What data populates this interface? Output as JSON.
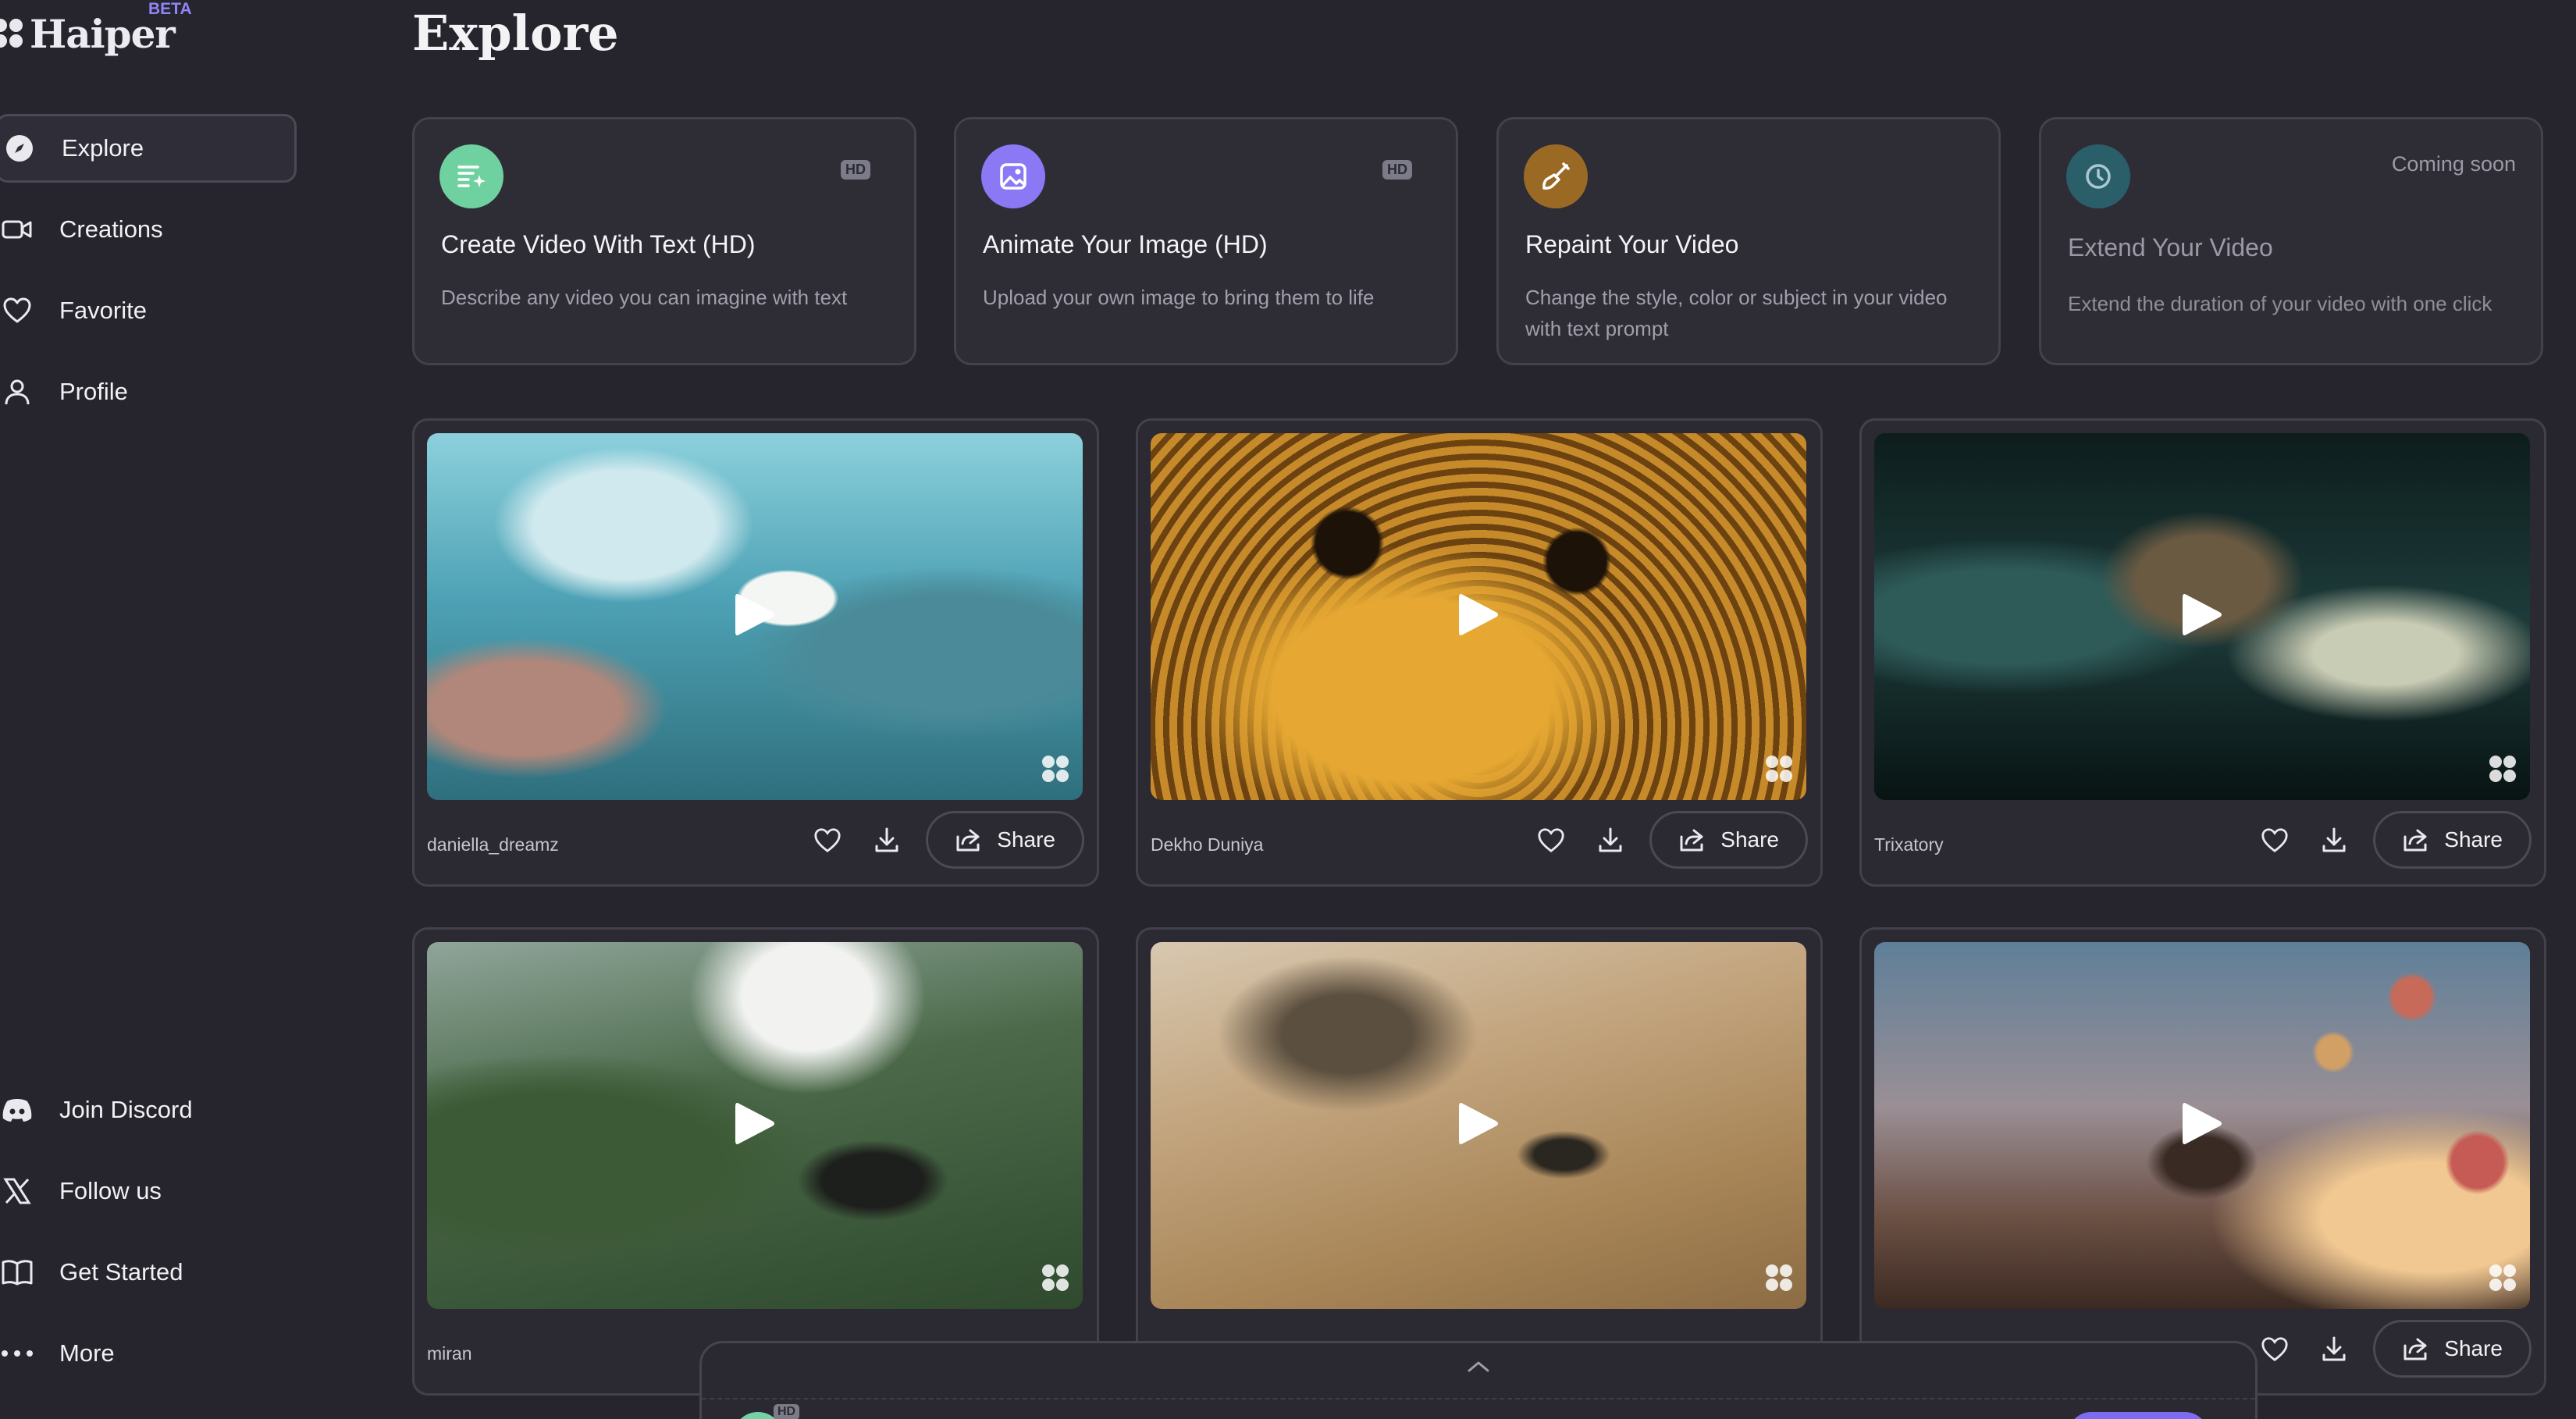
{
  "app": {
    "name": "Haiper",
    "badge": "BETA"
  },
  "sidebar": {
    "items": [
      {
        "label": "Explore",
        "icon": "compass-icon",
        "active": true
      },
      {
        "label": "Creations",
        "icon": "video-camera-icon",
        "active": false
      },
      {
        "label": "Favorite",
        "icon": "heart-icon",
        "active": false
      },
      {
        "label": "Profile",
        "icon": "user-icon",
        "active": false
      }
    ],
    "bottom_items": [
      {
        "label": "Join Discord",
        "icon": "discord-icon"
      },
      {
        "label": "Follow us",
        "icon": "x-logo-icon"
      },
      {
        "label": "Get Started",
        "icon": "book-icon"
      },
      {
        "label": "More",
        "icon": "more-dots-icon"
      }
    ]
  },
  "main": {
    "title": "Explore",
    "tools": [
      {
        "title": "Create Video With Text (HD)",
        "description": "Describe any video you can imagine with text",
        "badge": "HD",
        "icon": "text-to-video-icon",
        "color": "#6fd1a0"
      },
      {
        "title": "Animate Your Image (HD)",
        "description": "Upload your own image to bring them to life",
        "badge": "HD",
        "icon": "image-icon",
        "color": "#8a78f5"
      },
      {
        "title": "Repaint Your Video",
        "description": "Change the style, color or subject in your video with text prompt",
        "icon": "brush-icon",
        "color": "#9a6a24"
      },
      {
        "title": "Extend Your Video",
        "description": "Extend the duration of your video with one click",
        "status": "Coming soon",
        "icon": "clock-icon",
        "color": "#2a5f6a"
      }
    ],
    "share_label": "Share",
    "videos": [
      {
        "author": "daniella_dreamz",
        "scene": "underwater puppy"
      },
      {
        "author": "Dekho Duniya",
        "scene": "bees on honeycomb"
      },
      {
        "author": "Trixatory",
        "scene": "veiled woman"
      },
      {
        "author": "miran",
        "scene": "steam train in forest"
      },
      {
        "author": "",
        "scene": "car in desert dunes"
      },
      {
        "author": "",
        "scene": "child with balloons"
      }
    ]
  },
  "colors": {
    "background": "#26252e",
    "card": "#2b2a33",
    "border": "#42414c",
    "accent": "#8f86f5"
  }
}
